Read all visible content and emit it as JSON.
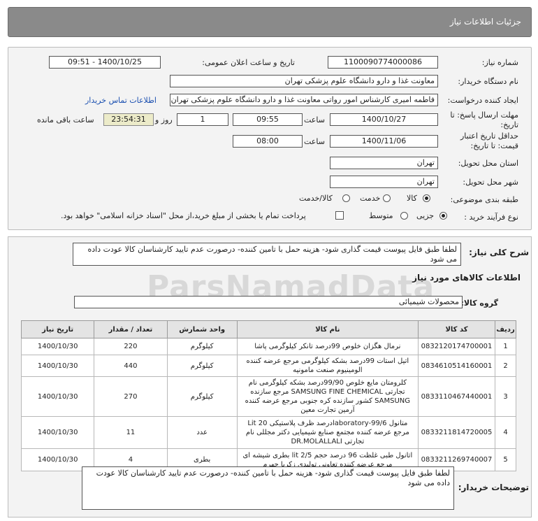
{
  "header": {
    "title": "جزئیات اطلاعات نیاز"
  },
  "form": {
    "need_number_label": "شماره نیاز:",
    "need_number": "1100090774000086",
    "announce_label": "تاریخ و ساعت اعلان عمومی:",
    "announce_value": "1400/10/25 - 09:51",
    "buyer_label": "نام دستگاه خریدار:",
    "buyer_value": "معاونت غذا و دارو دانشگاه علوم پزشکی تهران",
    "creator_label": "ایجاد کننده درخواست:",
    "creator_value": "فاطمه امیری کارشناس امور رواتی معاونت غذا و دارو دانشگاه علوم پزشکی تهران",
    "contact_link": "اطلاعات تماس خریدار",
    "deadline_label_1": "مهلت ارسال پاسخ: تا",
    "deadline_label_2": "تاریخ:",
    "deadline_date": "1400/10/27",
    "time_word": "ساعت",
    "deadline_time": "09:55",
    "days_value": "1",
    "days_word": "روز و",
    "remaining_timer": "23:54:31",
    "remaining_word": "ساعت باقی مانده",
    "validity_label_1": "حداقل تاریخ اعتبار",
    "validity_label_2": "قیمت: تا تاریخ:",
    "validity_date": "1400/11/06",
    "validity_time": "08:00",
    "province_label": "استان محل تحویل:",
    "province_value": "تهران",
    "city_label": "شهر محل تحویل:",
    "city_value": "تهران",
    "category_label": "طبقه بندی موضوعی:",
    "category_options": [
      "کالا",
      "خدمت",
      "کالا/خدمت"
    ],
    "category_selected": "کالا",
    "process_label": "نوع فرآیند خرید :",
    "process_options": [
      "جزیی",
      "متوسط"
    ],
    "process_selected": "جزیی",
    "payment_note": "پرداخت تمام یا بخشی از مبلغ خرید،از محل \"اسناد خزانه اسلامی\" خواهد بود."
  },
  "details": {
    "summary_label": "شرح کلی نیاز:",
    "summary_text": "لطفا طبق فایل پیوست قیمت گذاری شود- هزینه حمل با تامین کننده- درصورت عدم تایید کارشناسان کالا عودت داده می شود",
    "goods_info_title": "اطلاعات کالاهای مورد نیاز",
    "group_label": "گروه کالا:",
    "group_value": "محصولات شیمیائی",
    "columns": [
      "ردیف",
      "کد کالا",
      "نام کالا",
      "واحد شمارش",
      "تعداد / مقدار",
      "تاریخ نیاز"
    ],
    "rows": [
      {
        "n": "1",
        "code": "0832120174700001",
        "name": "نرمال هگزان خلوص 99درصد تانکر کیلوگرمی پاشا",
        "unit": "کیلوگرم",
        "qty": "220",
        "date": "1400/10/30"
      },
      {
        "n": "2",
        "code": "0834610514160001",
        "name": "اتیل استات 99درصد بشکه کیلوگرمی مرجع عرضه کننده الومینیوم صنعت مامونیه",
        "unit": "کیلوگرم",
        "qty": "440",
        "date": "1400/10/30"
      },
      {
        "n": "3",
        "code": "0833110467440001",
        "name": "کلرومتان مایع خلوص 99/90درصد بشکه کیلوگرمی نام تجارتی SAMSUNG FINE CHEMICAL مرجع سازنده SAMSUNG کشور سازنده کره جنوبی مرجع عرضه کننده آرمین تجارت معین",
        "unit": "کیلوگرم",
        "qty": "270",
        "date": "1400/10/30"
      },
      {
        "n": "4",
        "code": "0833211814720005",
        "name": "متانول laboratory-99/6درصد ظرف پلاستیکی 20 Lit مرجع عرضه کننده مجتمع صنایع شیمیایی دکتر مجللی نام تجارتی DR.MOLALLALI",
        "unit": "عدد",
        "qty": "11",
        "date": "1400/10/30"
      },
      {
        "n": "5",
        "code": "0833211269740007",
        "name": "اتانول طبی غلظت 96 درصد حجم lit 2/5 بطری شیشه ای مرجع عرضه کننده تعاونی تولیدی زکریا جهرم",
        "unit": "بطری",
        "qty": "4",
        "date": "1400/10/30"
      }
    ],
    "buyer_notes_label": "توضیحات خریدار:",
    "buyer_notes_text": "لطفا طبق فایل پیوست قیمت گذاری شود- هزینه حمل با تامین کننده- درصورت عدم تایید کارشناسان کالا عودت داده می شود",
    "watermark": "ParsNamadData"
  }
}
